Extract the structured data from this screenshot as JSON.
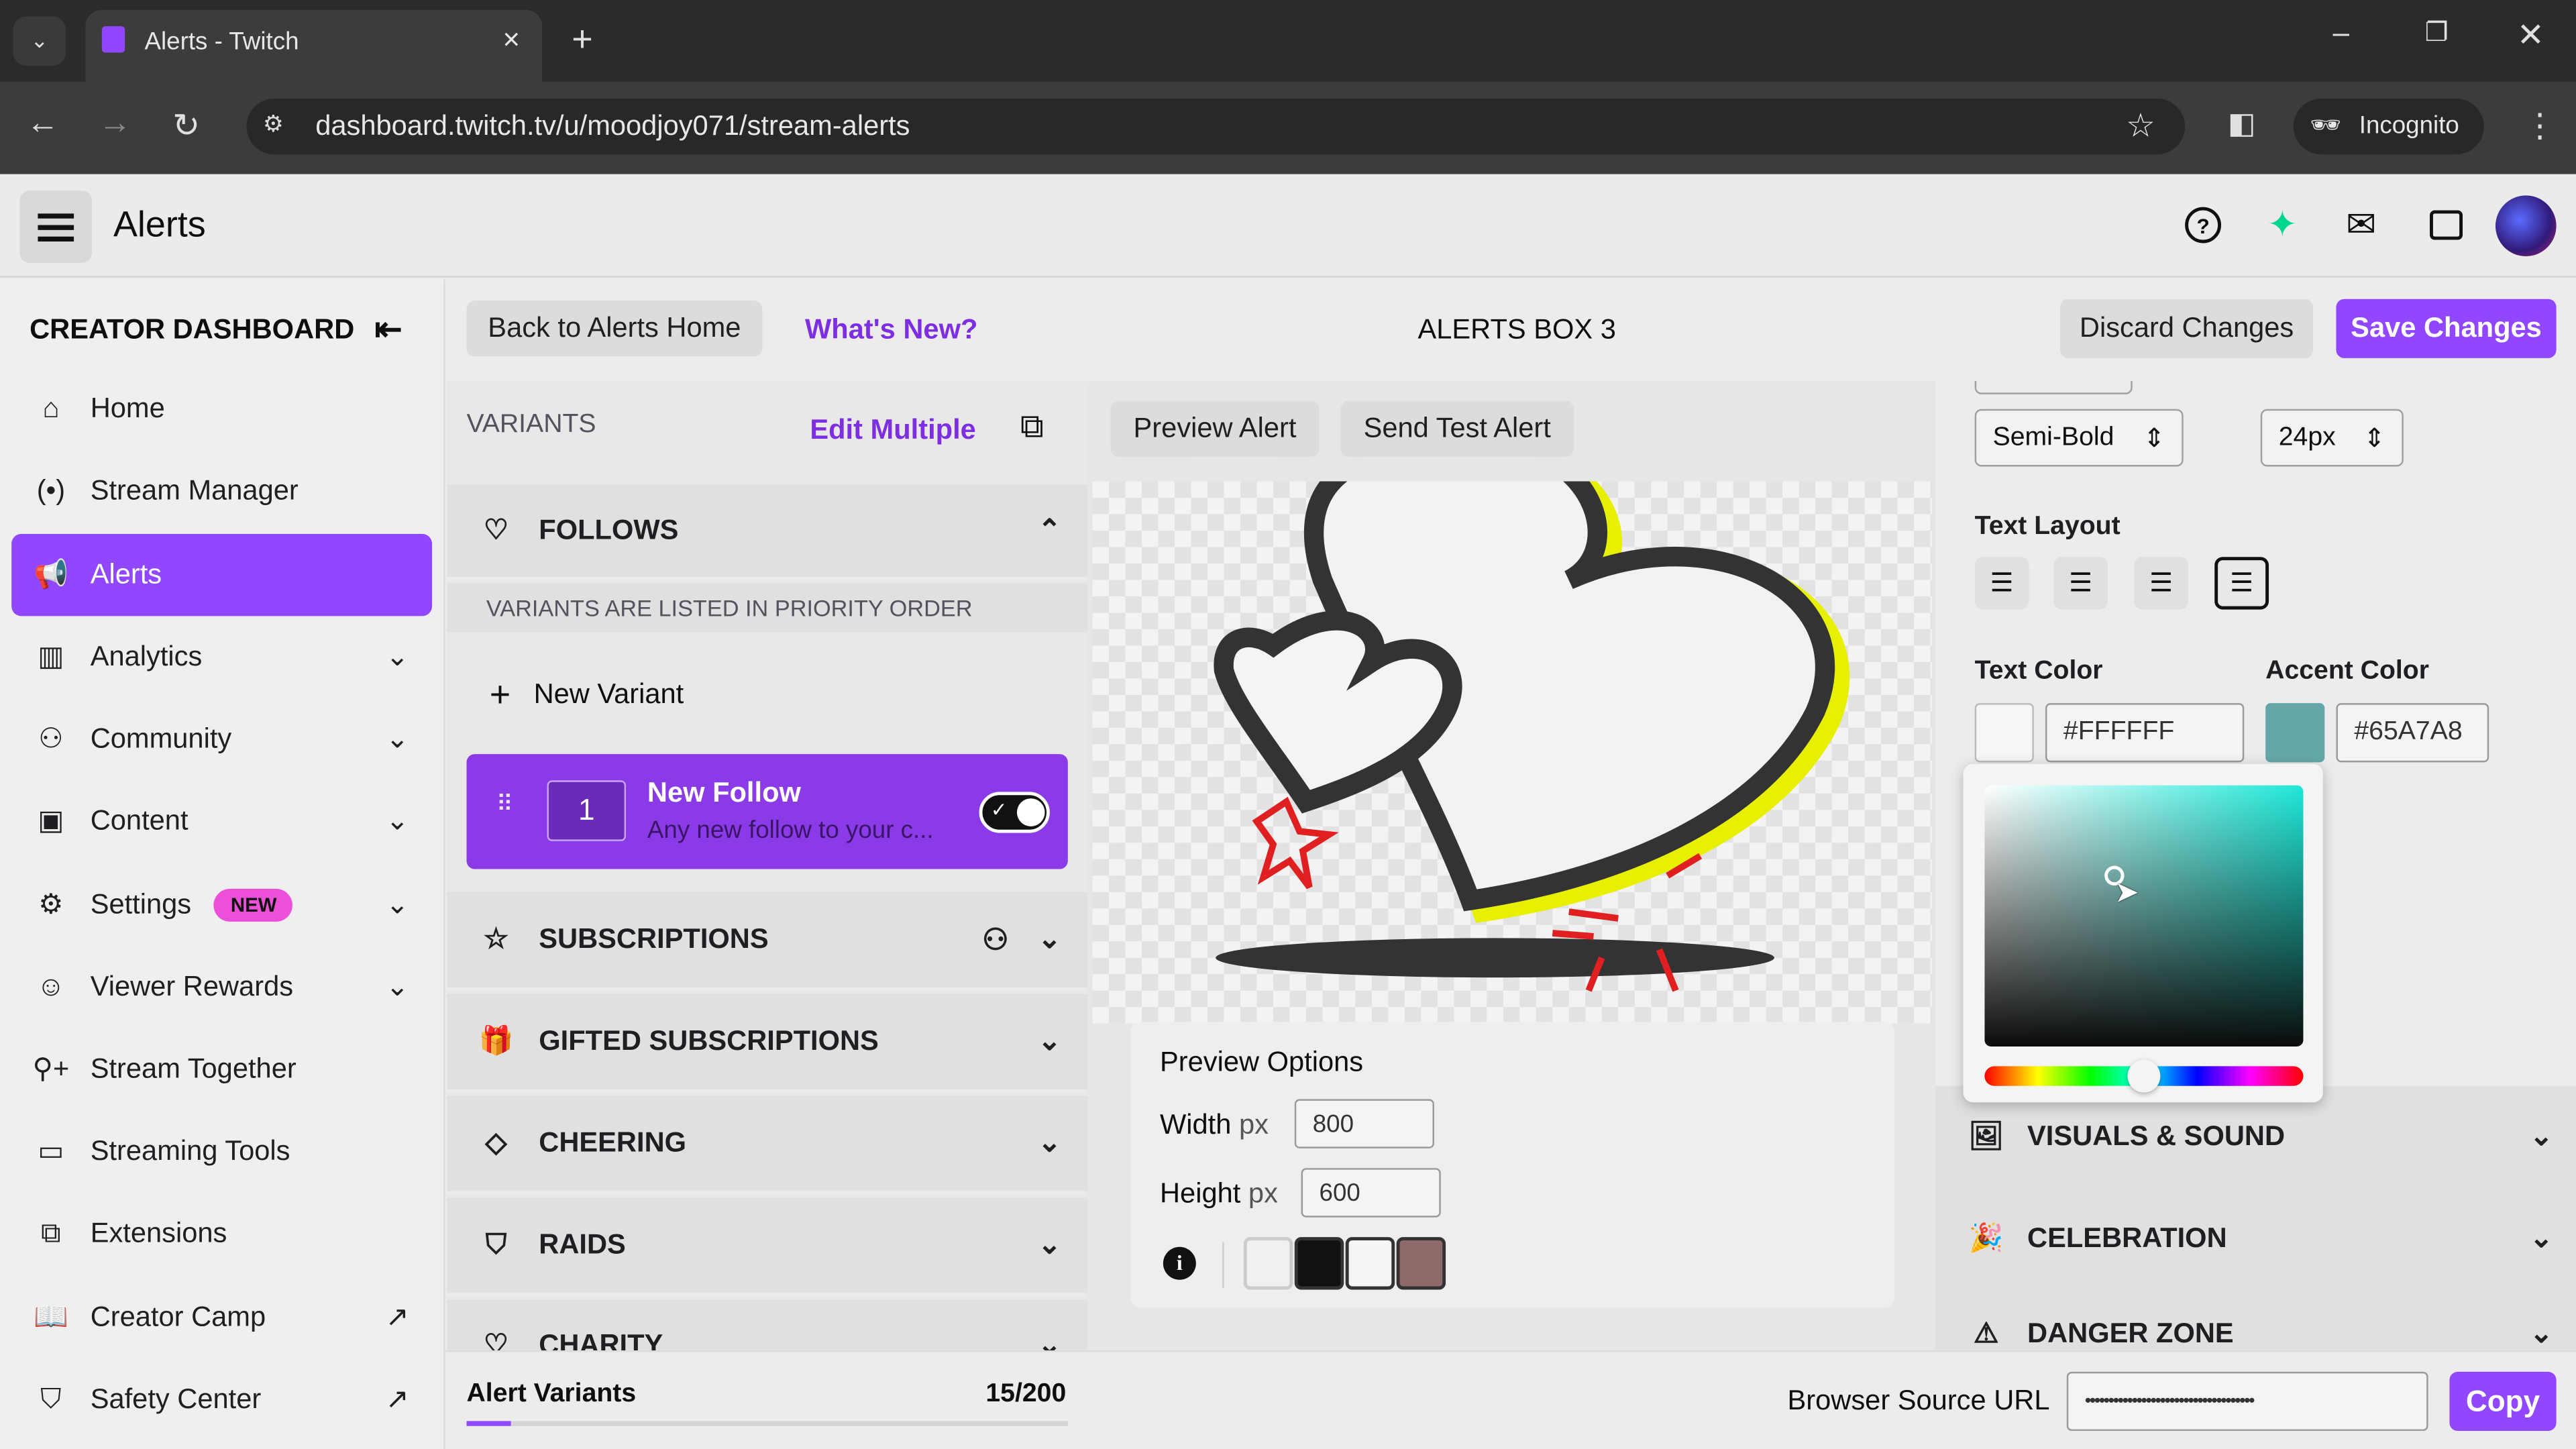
{
  "browser": {
    "tab_title": "Alerts - Twitch",
    "url": "dashboard.twitch.tv/u/moodjoy071/stream-alerts",
    "profile_label": "Incognito"
  },
  "app_header": {
    "title": "Alerts"
  },
  "sidebar": {
    "title": "CREATOR DASHBOARD",
    "items": [
      {
        "label": "Home",
        "icon": "home-icon"
      },
      {
        "label": "Stream Manager",
        "icon": "broadcast-icon"
      },
      {
        "label": "Alerts",
        "icon": "megaphone-icon",
        "active": true
      },
      {
        "label": "Analytics",
        "icon": "analytics-icon"
      },
      {
        "label": "Community",
        "icon": "community-icon"
      },
      {
        "label": "Content",
        "icon": "content-icon"
      },
      {
        "label": "Settings",
        "icon": "gear-icon",
        "badge": "NEW"
      },
      {
        "label": "Viewer Rewards",
        "icon": "rewards-icon"
      },
      {
        "label": "Stream Together",
        "icon": "user-plus-icon"
      },
      {
        "label": "Streaming Tools",
        "icon": "camera-icon"
      },
      {
        "label": "Extensions",
        "icon": "puzzle-icon"
      },
      {
        "label": "Creator Camp",
        "icon": "book-icon"
      },
      {
        "label": "Safety Center",
        "icon": "shield-icon"
      }
    ]
  },
  "toolbar": {
    "back_label": "Back to Alerts Home",
    "whats_new_label": "What's New?",
    "title": "ALERTS BOX 3",
    "discard_label": "Discard Changes",
    "save_label": "Save Changes"
  },
  "variants": {
    "header": "VARIANTS",
    "edit_multiple": "Edit Multiple",
    "follows_label": "FOLLOWS",
    "priority_note": "VARIANTS ARE LISTED IN PRIORITY ORDER",
    "new_variant": "New Variant",
    "card": {
      "number": "1",
      "title": "New Follow",
      "subtitle": "Any new follow to your c...",
      "enabled": true
    },
    "categories": [
      {
        "label": "SUBSCRIPTIONS"
      },
      {
        "label": "GIFTED SUBSCRIPTIONS"
      },
      {
        "label": "CHEERING"
      },
      {
        "label": "RAIDS"
      },
      {
        "label": "CHARITY"
      }
    ],
    "footer_label": "Alert Variants",
    "footer_count": "15/200",
    "usage_fraction": 0.075
  },
  "preview": {
    "preview_button": "Preview Alert",
    "test_button": "Send Test Alert",
    "options_title": "Preview Options",
    "width_label": "Width",
    "height_label": "Height",
    "unit": "px",
    "width_value": "800",
    "height_value": "600",
    "backgrounds": [
      "#f0f0f0",
      "#111111",
      "#f5f5f5",
      "#8f6a6a"
    ]
  },
  "text_settings": {
    "font_weight": "Semi-Bold",
    "font_size": "24px",
    "layout_label": "Text Layout",
    "layout_selected": "justify",
    "text_color_label": "Text Color",
    "text_color_value": "#FFFFFF",
    "accent_color_label": "Accent Color",
    "accent_color_value": "#65A7A8",
    "hue_position": 0.5
  },
  "sections": [
    {
      "label": "VISUALS & SOUND"
    },
    {
      "label": "CELEBRATION"
    },
    {
      "label": "DANGER ZONE"
    }
  ],
  "footer": {
    "browser_source_label": "Browser Source URL",
    "browser_source_value": "••••••••••••••••••••••••••••••••••••",
    "copy_label": "Copy"
  },
  "colors": {
    "brand": "#9147ff",
    "accent": "#65A7A8"
  }
}
